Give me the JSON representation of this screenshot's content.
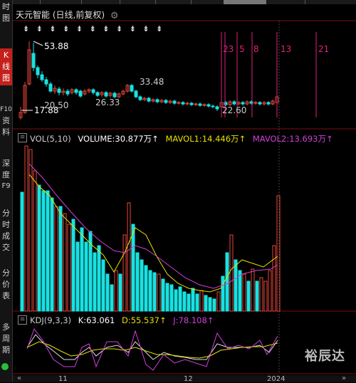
{
  "sidebar": {
    "items": [
      {
        "label": "时"
      },
      {
        "label": "图"
      },
      {
        "label": "K"
      },
      {
        "label": "线"
      },
      {
        "label": "图"
      },
      {
        "label": "F10"
      },
      {
        "label": "资"
      },
      {
        "label": "料"
      },
      {
        "label": "深"
      },
      {
        "label": "度"
      },
      {
        "label": "F9"
      },
      {
        "label": "分"
      },
      {
        "label": "时"
      },
      {
        "label": "成"
      },
      {
        "label": "交"
      },
      {
        "label": "分"
      },
      {
        "label": "价"
      },
      {
        "label": "表"
      },
      {
        "label": "多"
      },
      {
        "label": "周"
      },
      {
        "label": "期"
      }
    ]
  },
  "header": {
    "stock_name": "天元智能",
    "period_info": "(日线,前复权)",
    "settings_icon": "gear-icon"
  },
  "kline": {
    "event_markers": "⇟ ⇟ ⇟ ⇟ ⇟ ⇟ ⇟ ⇟ ⇟ ⇟ ⇟",
    "high_label": "53.88",
    "low_label": "17.88",
    "label_2050": "20.50",
    "label_2633": "26.33",
    "label_3348": "33.48",
    "label_2260": "22.60",
    "day_marks": [
      "23",
      "5",
      "8",
      "13",
      "21"
    ],
    "colors": {
      "up": "#e8463a",
      "down": "#17e2e2",
      "mark": "#e0207a"
    }
  },
  "volume": {
    "title": "VOL(5,10)",
    "volume": "VOLUME:30.877万",
    "mavol1": "MAVOL1:14.446万",
    "mavol2": "MAVOL2:13.693万",
    "colors": {
      "mavol1": "#e8e000",
      "mavol2": "#d040d8"
    }
  },
  "kdj": {
    "title": "KDJ(9,3,3)",
    "k": "K:63.061",
    "d": "D:55.537",
    "j": "J:78.108",
    "colors": {
      "k": "#e0e0e0",
      "d": "#e8e000",
      "j": "#d040d8"
    }
  },
  "axis": {
    "x_labels": [
      "11",
      "12",
      "2024"
    ]
  },
  "watermark": "裕辰达"
}
